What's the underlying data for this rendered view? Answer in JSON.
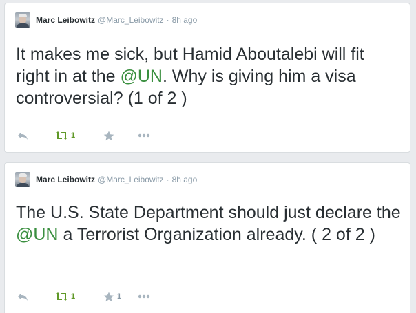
{
  "tweets": [
    {
      "author_name": "Marc Leibowitz",
      "handle": "@Marc_Leibowitz",
      "separator": "·",
      "time": "8h ago",
      "text_before": "It makes me sick, but Hamid Aboutalebi will fit right in at the ",
      "mention": "@UN",
      "text_after": ". Why is giving him a visa controversial? (1 of 2 )",
      "retweet_count": "1",
      "favorite_count": ""
    },
    {
      "author_name": "Marc Leibowitz",
      "handle": "@Marc_Leibowitz",
      "separator": "·",
      "time": "8h ago",
      "text_before": "The U.S. State Department should just declare the ",
      "mention": "@UN",
      "text_after": " a Terrorist Organization already. ( 2 of 2 )",
      "retweet_count": "1",
      "favorite_count": "1"
    }
  ],
  "colors": {
    "mention_link": "#3a8f3f",
    "retweet_green": "#609928",
    "icon_gray": "#a8b5bf",
    "name_text": "#292f33",
    "meta_gray": "#8899a6"
  },
  "icons": [
    "reply-icon",
    "retweet-icon",
    "favorite-star-icon",
    "more-dots-icon"
  ]
}
